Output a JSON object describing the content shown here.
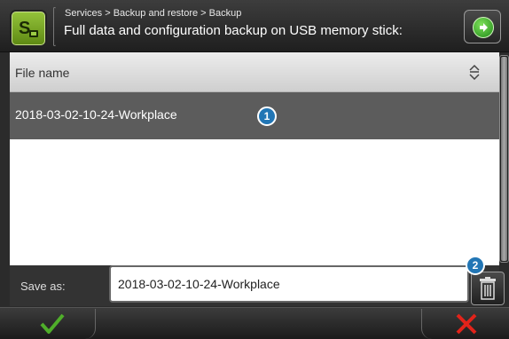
{
  "header": {
    "breadcrumb": "Services > Backup and restore > Backup",
    "subtitle": "Full data and configuration backup on USB memory stick:",
    "app_icon": "service-app-icon",
    "next_icon": "arrow-right-circle-icon"
  },
  "file_list": {
    "column_header": "File name",
    "sort_icon": "sort-up-down-icon",
    "rows": [
      {
        "name": "2018-03-02-10-24-Workplace",
        "selected": true
      }
    ]
  },
  "callouts": {
    "one": "1",
    "two": "2"
  },
  "save": {
    "label": "Save as:",
    "value": "2018-03-02-10-24-Workplace",
    "delete_icon": "trash-icon"
  },
  "footer": {
    "ok_icon": "checkmark-icon",
    "cancel_icon": "x-icon"
  },
  "colors": {
    "accent_green": "#5f8a14",
    "selected_row": "#5c5c5c",
    "badge_blue": "#2276b5",
    "cancel_red": "#e2231a",
    "ok_green": "#4fae2a"
  }
}
